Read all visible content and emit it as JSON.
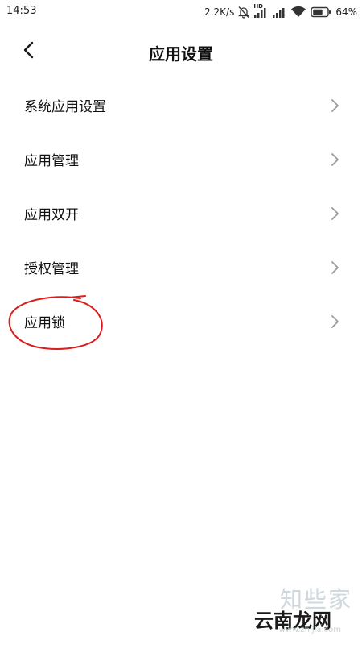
{
  "status_bar": {
    "time": "14:53",
    "network_speed": "2.2K/s",
    "hd_badge": "HD",
    "battery_percent": "64%",
    "icons": [
      "mute-icon",
      "hd-signal-icon",
      "signal-icon",
      "wifi-icon",
      "battery-icon"
    ]
  },
  "header": {
    "title": "应用设置",
    "back_icon": "chevron-left-icon"
  },
  "settings_list": {
    "items": [
      {
        "label": "系统应用设置"
      },
      {
        "label": "应用管理"
      },
      {
        "label": "应用双开"
      },
      {
        "label": "授权管理"
      },
      {
        "label": "应用锁"
      }
    ]
  },
  "annotation": {
    "circled_item": "应用锁",
    "color": "#d81e1e"
  },
  "watermark": {
    "line1": "知些家",
    "line2": "云南龙网",
    "url": "www.zhijia.com"
  },
  "colors": {
    "background": "#ffffff",
    "text": "#111111",
    "chevron": "#9a9a9a"
  }
}
